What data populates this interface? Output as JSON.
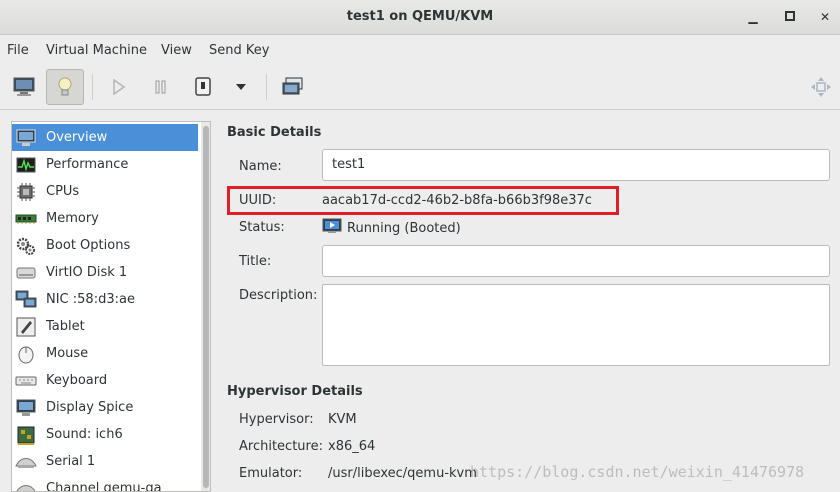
{
  "window": {
    "title": "test1 on QEMU/KVM"
  },
  "menu": [
    "File",
    "Virtual Machine",
    "View",
    "Send Key"
  ],
  "toolbar": {
    "buttons": [
      "console-icon",
      "lightbulb-icon",
      "play-icon",
      "pause-icon",
      "power-icon",
      "dropdown-icon",
      "snapshot-icon",
      "fullscreen-icon"
    ]
  },
  "sidebar": {
    "items": [
      {
        "label": "Overview",
        "icon": "monitor-icon"
      },
      {
        "label": "Performance",
        "icon": "performance-icon"
      },
      {
        "label": "CPUs",
        "icon": "cpu-icon"
      },
      {
        "label": "Memory",
        "icon": "memory-icon"
      },
      {
        "label": "Boot Options",
        "icon": "gears-icon"
      },
      {
        "label": "VirtIO Disk 1",
        "icon": "disk-icon"
      },
      {
        "label": "NIC :58:d3:ae",
        "icon": "nic-icon"
      },
      {
        "label": "Tablet",
        "icon": "tablet-icon"
      },
      {
        "label": "Mouse",
        "icon": "mouse-icon"
      },
      {
        "label": "Keyboard",
        "icon": "keyboard-icon"
      },
      {
        "label": "Display Spice",
        "icon": "display-icon"
      },
      {
        "label": "Sound: ich6",
        "icon": "sound-icon"
      },
      {
        "label": "Serial 1",
        "icon": "serial-icon"
      },
      {
        "label": "Channel qemu-ga",
        "icon": "channel-icon"
      }
    ]
  },
  "basic": {
    "heading": "Basic Details",
    "name_label": "Name:",
    "name_value": "test1",
    "uuid_label": "UUID:",
    "uuid_value": "aacab17d-ccd2-46b2-b8fa-b66b3f98e37c",
    "status_label": "Status:",
    "status_value": "Running (Booted)",
    "title_label": "Title:",
    "title_value": "",
    "description_label": "Description:",
    "description_value": ""
  },
  "hypervisor": {
    "heading": "Hypervisor Details",
    "hypervisor_label": "Hypervisor:",
    "hypervisor_value": "KVM",
    "arch_label": "Architecture:",
    "arch_value": "x86_64",
    "emulator_label": "Emulator:",
    "emulator_value": "/usr/libexec/qemu-kvm"
  },
  "watermark": "https://blog.csdn.net/weixin_41476978",
  "colors": {
    "selection": "#4a90d9",
    "highlight_box": "#e01e26"
  }
}
